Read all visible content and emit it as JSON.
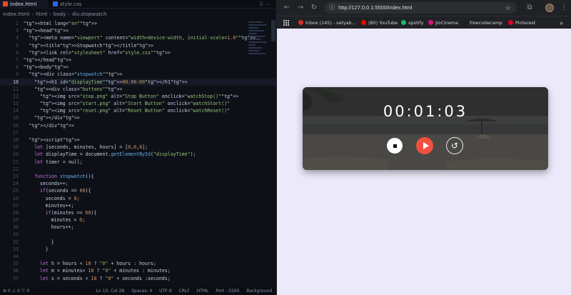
{
  "editor": {
    "tabs": [
      {
        "label": "index.html",
        "active": true
      },
      {
        "label": "style.css",
        "active": false
      }
    ],
    "breadcrumb": [
      "index.html",
      "html",
      "body",
      "div.stopwatch"
    ],
    "lines": [
      {
        "n": "2",
        "code": "<html lang=\"en\">"
      },
      {
        "n": "3",
        "code": "<head>"
      },
      {
        "n": "4",
        "code": "<meta name=\"viewport\" content=\"width=device-width, initial-scale=1.0\">"
      },
      {
        "n": "5",
        "code": "<title>Stopwatch</title>"
      },
      {
        "n": "6",
        "code": "<link rel=\"stylesheet\" href=\"style.css\">"
      },
      {
        "n": "7",
        "code": "</head>"
      },
      {
        "n": "8",
        "code": "<body>"
      },
      {
        "n": "9",
        "code": "<div class=\"stopwatch\">"
      },
      {
        "n": "10",
        "code": "<h1 id=\"displayTime\">00:00:00</h1>"
      },
      {
        "n": "11",
        "code": "<div class=\"buttons\">"
      },
      {
        "n": "12",
        "code": "<img src=\"stop.png\" alt=\"Stop Button\" onclick=\"watchStop()\">"
      },
      {
        "n": "13",
        "code": "<img src=\"start.png\" alt=\"Start Button\" onclick=\"watchStart()\""
      },
      {
        "n": "14",
        "code": "<img src=\"reset.png\" alt=\"Reset Button\" onclick=\"watchReset()\""
      },
      {
        "n": "15",
        "code": "</div>"
      },
      {
        "n": "16",
        "code": "</div>"
      },
      {
        "n": "17",
        "code": ""
      },
      {
        "n": "18",
        "code": "<script>"
      },
      {
        "n": "19",
        "code": "let [seconds, minutes, hours] = [0,0,0];"
      },
      {
        "n": "20",
        "code": "let displayTime = document.getElementById(\"displayTime\");"
      },
      {
        "n": "21",
        "code": "let timer = null;"
      },
      {
        "n": "22",
        "code": ""
      },
      {
        "n": "23",
        "code": "function stopwatch(){"
      },
      {
        "n": "24",
        "code": "seconds++;"
      },
      {
        "n": "25",
        "code": "if(seconds == 60){"
      },
      {
        "n": "26",
        "code": "seconds = 0;"
      },
      {
        "n": "27",
        "code": "minutes++;"
      },
      {
        "n": "28",
        "code": "if(minutes == 60){"
      },
      {
        "n": "29",
        "code": "minutes = 0;"
      },
      {
        "n": "30",
        "code": "hours++;"
      },
      {
        "n": "31",
        "code": ""
      },
      {
        "n": "32",
        "code": "}"
      },
      {
        "n": "33",
        "code": "}"
      },
      {
        "n": "34",
        "code": ""
      },
      {
        "n": "35",
        "code": "let h = hours < 10 ? \"0\" + hours : hours;"
      },
      {
        "n": "36",
        "code": "let m = minutes< 10 ? \"0\" + minutes : minutes;"
      },
      {
        "n": "37",
        "code": "let s = seconds < 10 ? \"0\" + seconds :seconds;"
      }
    ],
    "status_left": "⊗ 0  ⚠ 0  Ⓘ 0",
    "status_right": [
      "Ln 10, Col 28",
      "Spaces: 4",
      "UTF-8",
      "CRLF",
      "HTML",
      "Port : 5500",
      "Background"
    ]
  },
  "browser": {
    "url": "http://127.0.0.1:5500/index.html",
    "bookmarks": [
      "Inbox (145) - satyab...",
      "(80) YouTube",
      "spotify",
      "JioCinema",
      "freecodecamp",
      "Pinterest"
    ],
    "bookmark_colors": [
      "#d93025",
      "#ff0000",
      "#1db954",
      "#d6147b",
      "#1f1f1f",
      "#e60023"
    ]
  },
  "stopwatch": {
    "display_time": "00:01:03",
    "buttons": {
      "stop": "stop-icon",
      "start": "play-icon",
      "reset": "reset-icon"
    },
    "start_color": "#f2513f"
  }
}
